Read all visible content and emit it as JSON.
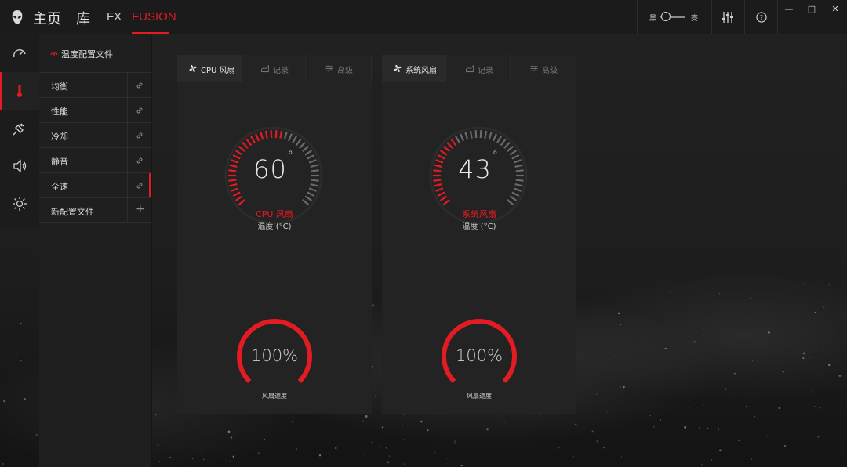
{
  "nav": {
    "home": "主页",
    "library": "库",
    "fx": "FX",
    "fusion": "FUSION"
  },
  "topbar": {
    "theme_dark_label": "黑",
    "theme_light_label": "亮",
    "minimize": "—",
    "maximize": "□",
    "close": "✕"
  },
  "profiles": {
    "header": "温度配置文件",
    "items": [
      {
        "label": "均衡",
        "selected": false
      },
      {
        "label": "性能",
        "selected": false
      },
      {
        "label": "冷却",
        "selected": false
      },
      {
        "label": "静音",
        "selected": false
      },
      {
        "label": "全速",
        "selected": true
      }
    ],
    "new_profile": "新配置文件"
  },
  "cards": [
    {
      "tabs": [
        {
          "label": "CPU 风扇",
          "icon": "fan-icon",
          "active": true
        },
        {
          "label": "记录",
          "icon": "chart-icon",
          "active": false
        },
        {
          "label": "高级",
          "icon": "sliders-icon",
          "active": false
        }
      ],
      "temperature": {
        "value": "60",
        "degree": "°",
        "fraction": 0.55
      },
      "gauge_title": "CPU 风扇",
      "gauge_sub": "温度 (°C)",
      "fan_speed": {
        "value": "100%",
        "fraction": 1.0
      },
      "fan_label": "风扇速度"
    },
    {
      "tabs": [
        {
          "label": "系统风扇",
          "icon": "fan-icon",
          "active": true
        },
        {
          "label": "记录",
          "icon": "chart-icon",
          "active": false
        },
        {
          "label": "高级",
          "icon": "sliders-icon",
          "active": false
        }
      ],
      "temperature": {
        "value": "43",
        "degree": "°",
        "fraction": 0.38
      },
      "gauge_title": "系统风扇",
      "gauge_sub": "温度 (°C)",
      "fan_speed": {
        "value": "100%",
        "fraction": 1.0
      },
      "fan_label": "风扇速度"
    }
  ],
  "colors": {
    "accent": "#e31b23",
    "tick_inactive": "#6a6a6a",
    "panel": "#232323"
  }
}
